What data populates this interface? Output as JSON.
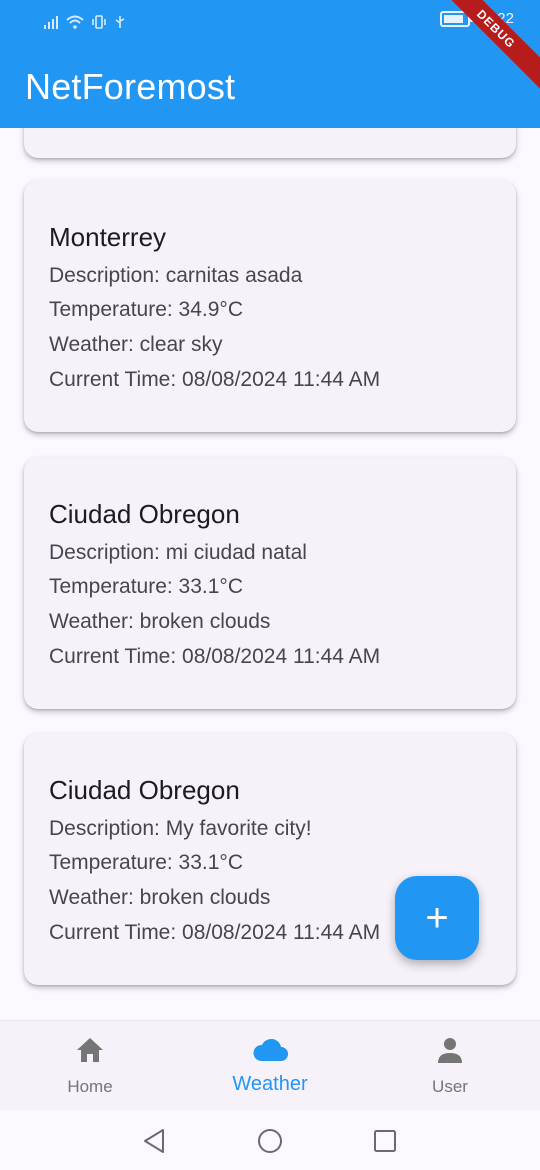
{
  "status_bar": {
    "time": "10:22"
  },
  "app_bar": {
    "title": "NetForemost",
    "debug_label": "DEBUG"
  },
  "cards": [
    {
      "city": "Monterrey",
      "description": "Description: carnitas asada",
      "temperature": "Temperature: 34.9°C",
      "weather": "Weather: clear sky",
      "time": "Current Time: 08/08/2024 11:44 AM"
    },
    {
      "city": "Ciudad Obregon",
      "description": "Description: mi ciudad natal",
      "temperature": "Temperature: 33.1°C",
      "weather": "Weather: broken clouds",
      "time": "Current Time: 08/08/2024 11:44 AM"
    },
    {
      "city": "Ciudad Obregon",
      "description": "Description: My favorite city!",
      "temperature": "Temperature: 33.1°C",
      "weather": "Weather: broken clouds",
      "time": "Current Time: 08/08/2024 11:44 AM"
    }
  ],
  "fab": {
    "label": "+"
  },
  "bottom_nav": {
    "items": [
      {
        "label": "Home",
        "icon": "home-icon",
        "active": false
      },
      {
        "label": "Weather",
        "icon": "cloud-icon",
        "active": true
      },
      {
        "label": "User",
        "icon": "person-icon",
        "active": false
      }
    ]
  },
  "colors": {
    "primary": "#2196f3",
    "background": "#fdf7ff",
    "card": "#f7f2fa",
    "inactive_nav": "#757575",
    "debug_ribbon": "#b71c1c"
  }
}
